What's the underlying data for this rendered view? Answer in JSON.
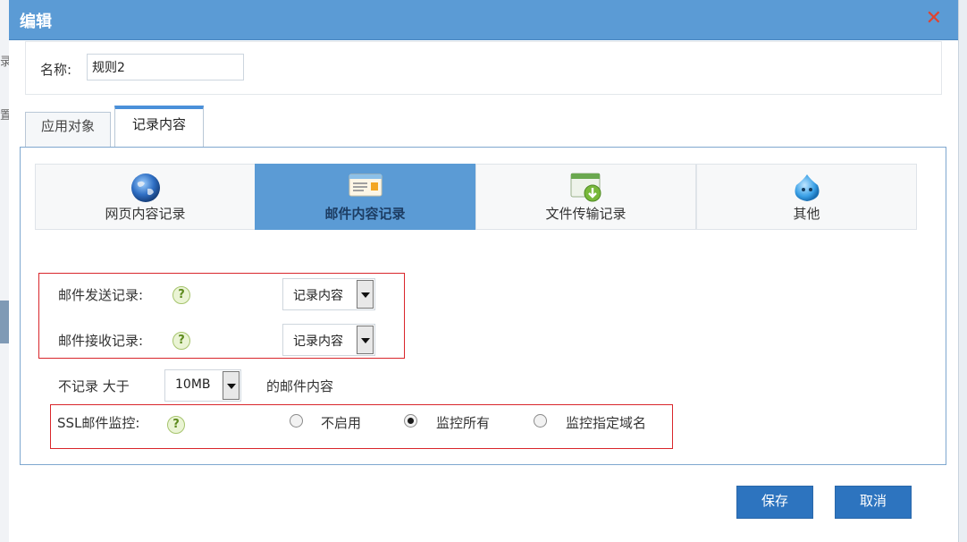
{
  "background": {
    "fragment_1": "录",
    "fragment_2": "置"
  },
  "dialog": {
    "title": "编辑",
    "close_glyph": "✕",
    "name_label": "名称:",
    "name_value": "规则2"
  },
  "tabs": [
    {
      "label": "应用对象",
      "selected": false
    },
    {
      "label": "记录内容",
      "selected": true
    }
  ],
  "categories": [
    {
      "label": "网页内容记录",
      "icon": "globe-icon",
      "active": false
    },
    {
      "label": "邮件内容记录",
      "icon": "mail-card-icon",
      "active": true
    },
    {
      "label": "文件传输记录",
      "icon": "file-download-icon",
      "active": false
    },
    {
      "label": "其他",
      "icon": "water-drop-icon",
      "active": false
    }
  ],
  "mail": {
    "send_label": "邮件发送记录:",
    "send_value": "记录内容",
    "receive_label": "邮件接收记录:",
    "receive_value": "记录内容",
    "skip_prefix": "不记录  大于",
    "skip_size": "10MB",
    "skip_suffix": "的邮件内容",
    "ssl_label": "SSL邮件监控:",
    "ssl_options": [
      {
        "label": "不启用",
        "checked": false
      },
      {
        "label": "监控所有",
        "checked": true
      },
      {
        "label": "监控指定域名",
        "checked": false
      }
    ],
    "help_glyph": "?"
  },
  "buttons": {
    "save": "保存",
    "cancel": "取消"
  },
  "colors": {
    "titlebar": "#5b9bd5",
    "close": "#e0432e",
    "active_category": "#5b9bd5",
    "highlight_box": "#d9262b",
    "button": "#2d74bf"
  }
}
